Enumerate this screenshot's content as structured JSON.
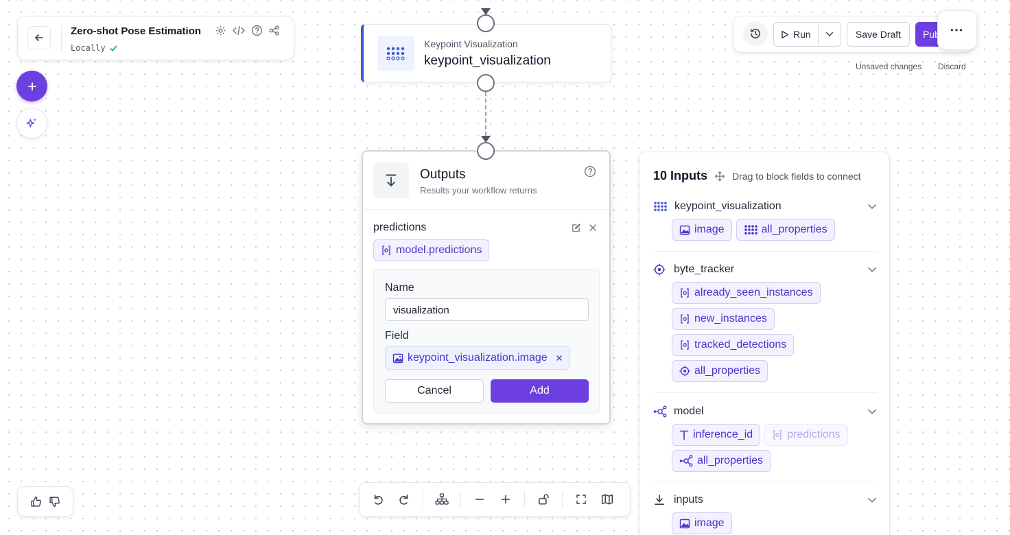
{
  "workflow": {
    "title": "Zero-shot Pose Estimation",
    "location": "Locally"
  },
  "node": {
    "type": "Keypoint Visualization",
    "name": "keypoint_visualization"
  },
  "toolbar": {
    "run": "Run",
    "save_draft": "Save Draft",
    "publish": "Pub",
    "more": "•••",
    "unsaved": "Unsaved changes",
    "discard": "Discard"
  },
  "outputs": {
    "title": "Outputs",
    "subtitle": "Results your workflow returns",
    "existing_name": "predictions",
    "existing_value": "model.predictions",
    "name_label": "Name",
    "name_value": "visualization",
    "field_label": "Field",
    "field_value": "keypoint_visualization.image",
    "cancel": "Cancel",
    "add": "Add"
  },
  "inputs_panel": {
    "count_title": "10 Inputs",
    "hint": "Drag to block fields to connect",
    "sections": [
      {
        "name": "keypoint_visualization",
        "icon": "grid-dots-icon",
        "chips": [
          "image",
          "all_properties"
        ]
      },
      {
        "name": "byte_tracker",
        "icon": "target-icon",
        "chips": [
          "already_seen_instances",
          "new_instances",
          "tracked_detections",
          "all_properties"
        ]
      },
      {
        "name": "model",
        "icon": "model-graph-icon",
        "chips": [
          "inference_id",
          "predictions",
          "all_properties"
        ]
      },
      {
        "name": "inputs",
        "icon": "download-icon",
        "chips": [
          "image"
        ]
      }
    ]
  },
  "colors": {
    "accent": "#6d3ee0",
    "node_bar": "#3b5bdb",
    "chip_text": "#4338ca"
  }
}
